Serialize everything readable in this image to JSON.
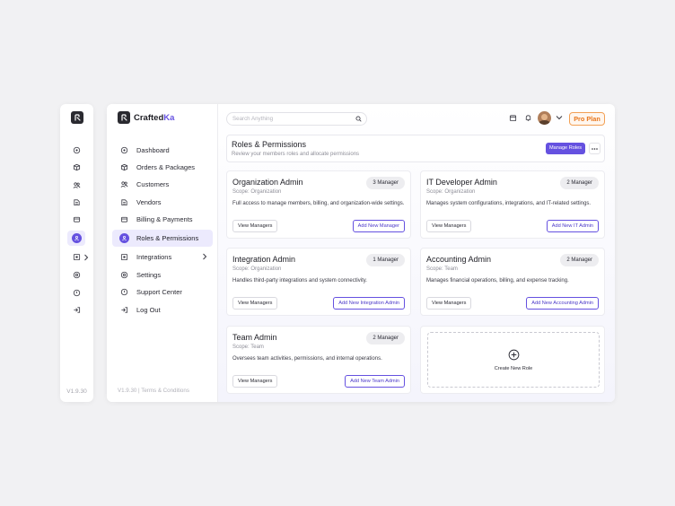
{
  "rail": {
    "version": "V1.9.30",
    "items": [
      {
        "icon": "dashboard-icon"
      },
      {
        "icon": "orders-icon"
      },
      {
        "icon": "customers-icon"
      },
      {
        "icon": "vendors-icon"
      },
      {
        "icon": "billing-icon"
      },
      {
        "icon": "roles-icon",
        "active": true
      },
      {
        "icon": "integrations-icon"
      },
      {
        "icon": "settings-icon"
      },
      {
        "icon": "support-icon"
      },
      {
        "icon": "logout-icon"
      }
    ]
  },
  "brand": {
    "name_main": "Crafted",
    "name_accent": "Ka"
  },
  "sidebar": {
    "items": [
      {
        "label": "Dashboard",
        "icon": "dashboard-icon"
      },
      {
        "label": "Orders & Packages",
        "icon": "orders-icon"
      },
      {
        "label": "Customers",
        "icon": "customers-icon"
      },
      {
        "label": "Vendors",
        "icon": "vendors-icon"
      },
      {
        "label": "Billing & Payments",
        "icon": "billing-icon"
      },
      {
        "label": "Roles & Permissions",
        "icon": "roles-icon",
        "active": true
      },
      {
        "label": "Integrations",
        "icon": "integrations-icon",
        "has_submenu": true
      },
      {
        "label": "Settings",
        "icon": "settings-icon"
      },
      {
        "label": "Support Center",
        "icon": "support-icon"
      },
      {
        "label": "Log Out",
        "icon": "logout-icon"
      }
    ],
    "footer": "V1.9.30 | Terms & Conditions"
  },
  "topbar": {
    "search_placeholder": "Search Anything",
    "plan_label": "Pro Plan"
  },
  "header": {
    "title": "Roles & Permissions",
    "subtitle": "Review your members roles and allocate permissions",
    "manage_button": "Manage Roles"
  },
  "roles": [
    {
      "title": "Organization Admin",
      "scope": "Scope: Organization",
      "badge": "3 Manager",
      "description": "Full access to manage members, billing, and organization-wide settings.",
      "view_label": "View Managers",
      "add_label": "Add New Manager"
    },
    {
      "title": "IT Developer Admin",
      "scope": "Scope: Organization",
      "badge": "2 Manager",
      "description": "Manages system configurations, integrations, and IT-related settings.",
      "view_label": "View Managers",
      "add_label": "Add New IT Admin"
    },
    {
      "title": "Integration Admin",
      "scope": "Scope: Organization",
      "badge": "1 Manager",
      "description": "Handles third-party integrations and system connectivity.",
      "view_label": "View Managers",
      "add_label": "Add New Integration Admin"
    },
    {
      "title": "Accounting Admin",
      "scope": "Scope: Team",
      "badge": "2 Manager",
      "description": "Manages financial operations, billing, and expense tracking.",
      "view_label": "View Managers",
      "add_label": "Add New Accounting Admin"
    },
    {
      "title": "Team Admin",
      "scope": "Scope: Team",
      "badge": "2 Manager",
      "description": "Oversees team activities, permissions, and internal operations.",
      "view_label": "View Managers",
      "add_label": "Add New Team Admin"
    }
  ],
  "create_role": {
    "label": "Create New Role"
  },
  "colors": {
    "accent": "#6551e0",
    "plan": "#e8761c"
  }
}
